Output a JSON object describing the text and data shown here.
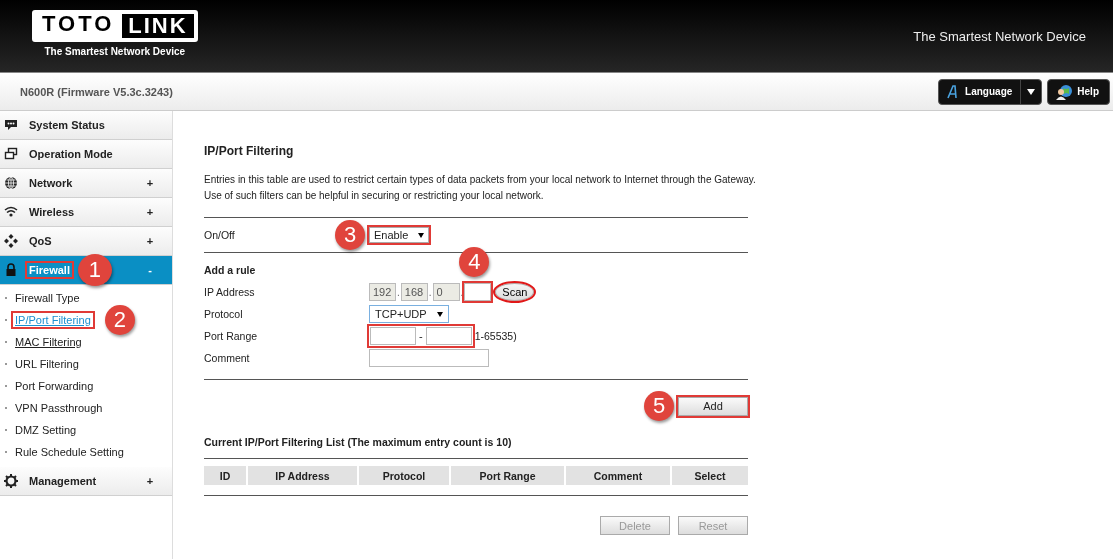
{
  "header": {
    "logo": {
      "part_1": "TOTO",
      "part_2": "LINK",
      "tagline": "The Smartest Network Device"
    },
    "slogan": "The Smartest Network Device"
  },
  "device_bar": {
    "model": "N600R (Firmware V5.3c.3243)",
    "language_button": "Language",
    "help_button": "Help"
  },
  "sidebar": {
    "items": [
      {
        "label": "System Status"
      },
      {
        "label": "Operation Mode"
      },
      {
        "label": "Network",
        "toggle": "+",
        "selected": false
      },
      {
        "label": "Wireless",
        "toggle": "+",
        "selected": false
      },
      {
        "label": "QoS",
        "toggle": "+",
        "selected": false
      },
      {
        "label": "Firewall",
        "toggle": "-",
        "expanded": true,
        "selected": true,
        "highlighted": true,
        "callout": "1",
        "children": [
          {
            "label": "Firewall Type",
            "selected": false,
            "hovered": false
          },
          {
            "label": "IP/Port Filtering",
            "selected": true,
            "hovered": false,
            "highlighted": true,
            "callout": "2"
          },
          {
            "label": "MAC Filtering",
            "selected": false,
            "hovered": true
          },
          {
            "label": "URL Filtering",
            "selected": false,
            "hovered": false
          },
          {
            "label": "Port Forwarding",
            "selected": false,
            "hovered": false
          },
          {
            "label": "VPN Passthrough",
            "selected": false,
            "hovered": false
          },
          {
            "label": "DMZ Setting",
            "selected": false,
            "hovered": false
          },
          {
            "label": "Rule Schedule Setting",
            "selected": false,
            "hovered": false
          }
        ]
      },
      {
        "label": "Management",
        "toggle": "+",
        "selected": false
      }
    ]
  },
  "content": {
    "title": "IP/Port Filtering",
    "description": [
      "Entries in this table are used to restrict certain types of data packets from your local network to Internet through the Gateway.",
      "Use of such filters can be helpful in securing or restricting your local network."
    ],
    "on_off": {
      "label": "On/Off",
      "value": "Enable",
      "highlighted": true,
      "callout": "3"
    },
    "add_rule": {
      "heading": "Add a rule",
      "ip_address": {
        "label": "IP Address",
        "separator": ".",
        "octets": [
          {
            "value": "192",
            "disabled": true
          },
          {
            "value": "168",
            "disabled": true
          },
          {
            "value": "0",
            "disabled": true
          },
          {
            "disabled": false,
            "highlighted": true,
            "callout": "4"
          }
        ],
        "scan_button": {
          "label": "Scan",
          "circled": true
        }
      },
      "protocol": {
        "label": "Protocol",
        "value": "TCP+UDP",
        "focused": true
      },
      "port_range": {
        "label": "Port Range",
        "separator": "-",
        "hint": "1-65535)",
        "highlighted": true
      },
      "comment": {
        "label": "Comment"
      }
    },
    "add_button": {
      "label": "Add",
      "highlighted": true,
      "callout": "5"
    },
    "list": {
      "title": "Current IP/Port Filtering List  (The maximum entry count is 10)",
      "columns": [
        "ID",
        "IP Address",
        "Protocol",
        "Port Range",
        "Comment",
        "Select"
      ]
    },
    "buttons": [
      {
        "label": "Delete",
        "disabled": true
      },
      {
        "label": "Reset",
        "disabled": true
      }
    ]
  }
}
